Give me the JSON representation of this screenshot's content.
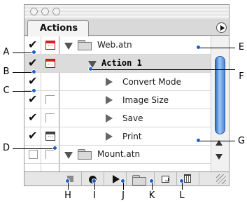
{
  "palette": {
    "title": "Actions"
  },
  "rows": [
    {
      "type": "set",
      "label": "Web.atn",
      "checked": true,
      "dialog": "red"
    },
    {
      "type": "action",
      "label": "Action 1",
      "checked": true,
      "dialog": "red"
    },
    {
      "type": "step",
      "label": "Convert Mode",
      "checked": true,
      "dialog": "none"
    },
    {
      "type": "step",
      "label": "Image Size",
      "checked": true,
      "dialog": "empty"
    },
    {
      "type": "step",
      "label": "Save",
      "checked": true,
      "dialog": "empty"
    },
    {
      "type": "step",
      "label": "Print",
      "checked": true,
      "dialog": "black"
    },
    {
      "type": "set",
      "label": "Mount.atn",
      "checked": false,
      "dialog": "empty"
    }
  ],
  "callouts": {
    "A": "A",
    "B": "B",
    "C": "C",
    "D": "D",
    "E": "E",
    "F": "F",
    "G": "G",
    "H": "H",
    "I": "I",
    "J": "J",
    "K": "K",
    "L": "L"
  },
  "toolbar_icons": [
    "stop-icon",
    "record-icon",
    "play-icon",
    "new-set-icon",
    "new-action-icon",
    "trash-icon"
  ],
  "colors": {
    "accent_dot": "#1a5fd0",
    "scroll_thumb": "#4b86d8",
    "dialog_red": "#cc0000"
  }
}
